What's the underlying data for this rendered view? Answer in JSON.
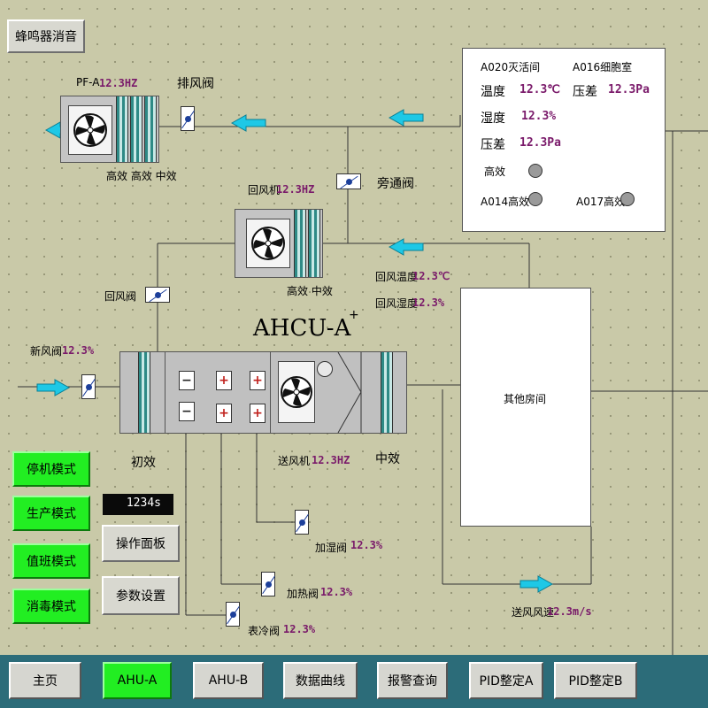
{
  "mute_button": "蜂鸣器消音",
  "exhaust": {
    "label": "PF-A",
    "hz": "12.3HZ",
    "damper_label": "排风阀",
    "filter_labels": "高效 高效 中效"
  },
  "return_fan": {
    "label": "回风机",
    "hz": "12.3HZ",
    "filter_labels": "高效 中效"
  },
  "bypass_label": "旁通阀",
  "return_damper_label": "回风阀",
  "fresh_air": {
    "label": "新风阀",
    "value": "12.3%"
  },
  "ahu_title": "AHCU-A",
  "primary_filter_label": "初效",
  "mid_filter_label": "中效",
  "supply_fan": {
    "label": "送风机",
    "hz": "12.3HZ"
  },
  "return_air": {
    "temp_label": "回风温度",
    "temp": "12.3℃",
    "hum_label": "回风湿度",
    "hum": "12.3%"
  },
  "room_a020": {
    "title": "A020灭活间",
    "temp_label": "温度",
    "temp": "12.3℃",
    "hum_label": "湿度",
    "hum": "12.3%",
    "press_label": "压差",
    "press": "12.3Pa",
    "hepa_label": "高效",
    "a014_label": "A014高效"
  },
  "room_a016": {
    "title": "A016细胞室",
    "press_label": "压差",
    "press": "12.3Pa",
    "a017_label": "A017高效"
  },
  "other_room": "其他房间",
  "humidify": {
    "label": "加湿阀",
    "value": "12.3%"
  },
  "heating": {
    "label": "加热阀",
    "value": "12.3%"
  },
  "cooling": {
    "label": "表冷阀",
    "value": "12.3%"
  },
  "supply_speed": {
    "label": "送风风速",
    "value": "12.3m/s"
  },
  "counter": "1234s",
  "modes": [
    "停机模式",
    "生产模式",
    "值班模式",
    "消毒模式"
  ],
  "op_panel": "操作面板",
  "params": "参数设置",
  "nav": [
    "主页",
    "AHU-A",
    "AHU-B",
    "数据曲线",
    "报警查询",
    "PID整定A",
    "PID整定B"
  ],
  "colors": {
    "background": "#c9c9a8",
    "active": "#22ee22",
    "value": "#7a1a6a",
    "pipe_arrow": "#1ec8e6",
    "bar": "#2c6c79"
  }
}
